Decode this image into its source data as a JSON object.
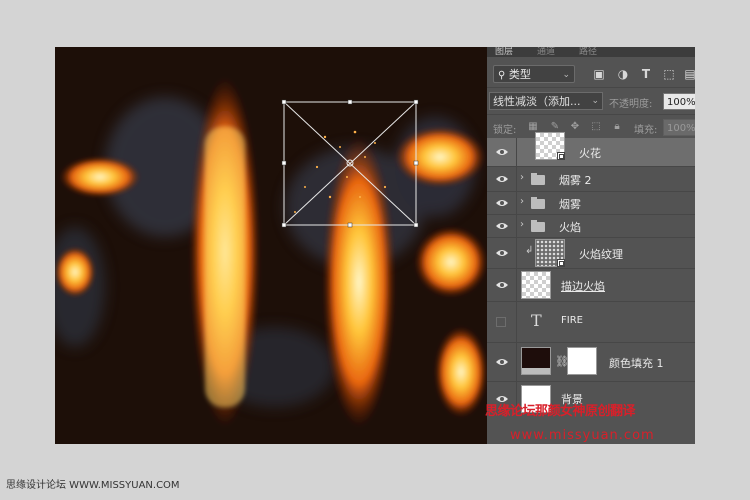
{
  "panel": {
    "tabs": [
      "图层",
      "通道",
      "路径"
    ],
    "filter": {
      "label": "类型",
      "icons": [
        "image-filter-icon",
        "adjustment-filter-icon",
        "type-filter-icon",
        "shape-filter-icon",
        "smartobject-filter-icon"
      ]
    },
    "blend_mode": "线性减淡（添加...",
    "opacity_label": "不透明度:",
    "opacity_value": "100%",
    "lock_label": "锁定:",
    "fill_label": "填充:",
    "fill_value": "100%",
    "layers": [
      {
        "name": "火花",
        "kind": "smart",
        "visible": true,
        "selected": true
      },
      {
        "name": "烟雾 2",
        "kind": "group",
        "visible": true
      },
      {
        "name": "烟雾",
        "kind": "group",
        "visible": true
      },
      {
        "name": "火焰",
        "kind": "group",
        "visible": true
      },
      {
        "name": "火焰纹理",
        "kind": "smart-clipped",
        "visible": true
      },
      {
        "name": "描边火焰",
        "kind": "raster",
        "visible": true
      },
      {
        "name": "FIRE",
        "kind": "text",
        "visible": false
      },
      {
        "name": "颜色填充 1",
        "kind": "fill",
        "visible": true
      },
      {
        "name": "背景",
        "kind": "background",
        "visible": true
      }
    ]
  },
  "watermark": {
    "line1": "思缘论坛那颜女神原创翻译",
    "url": "www.missyuan.com"
  },
  "footer": "思缘设计论坛 WWW.MISSYUAN.COM",
  "colors": {
    "canvas_bg": "#1d0f08",
    "panel_bg": "#535353",
    "selected_row": "#6e6e6e",
    "watermark": "#d8202a"
  }
}
